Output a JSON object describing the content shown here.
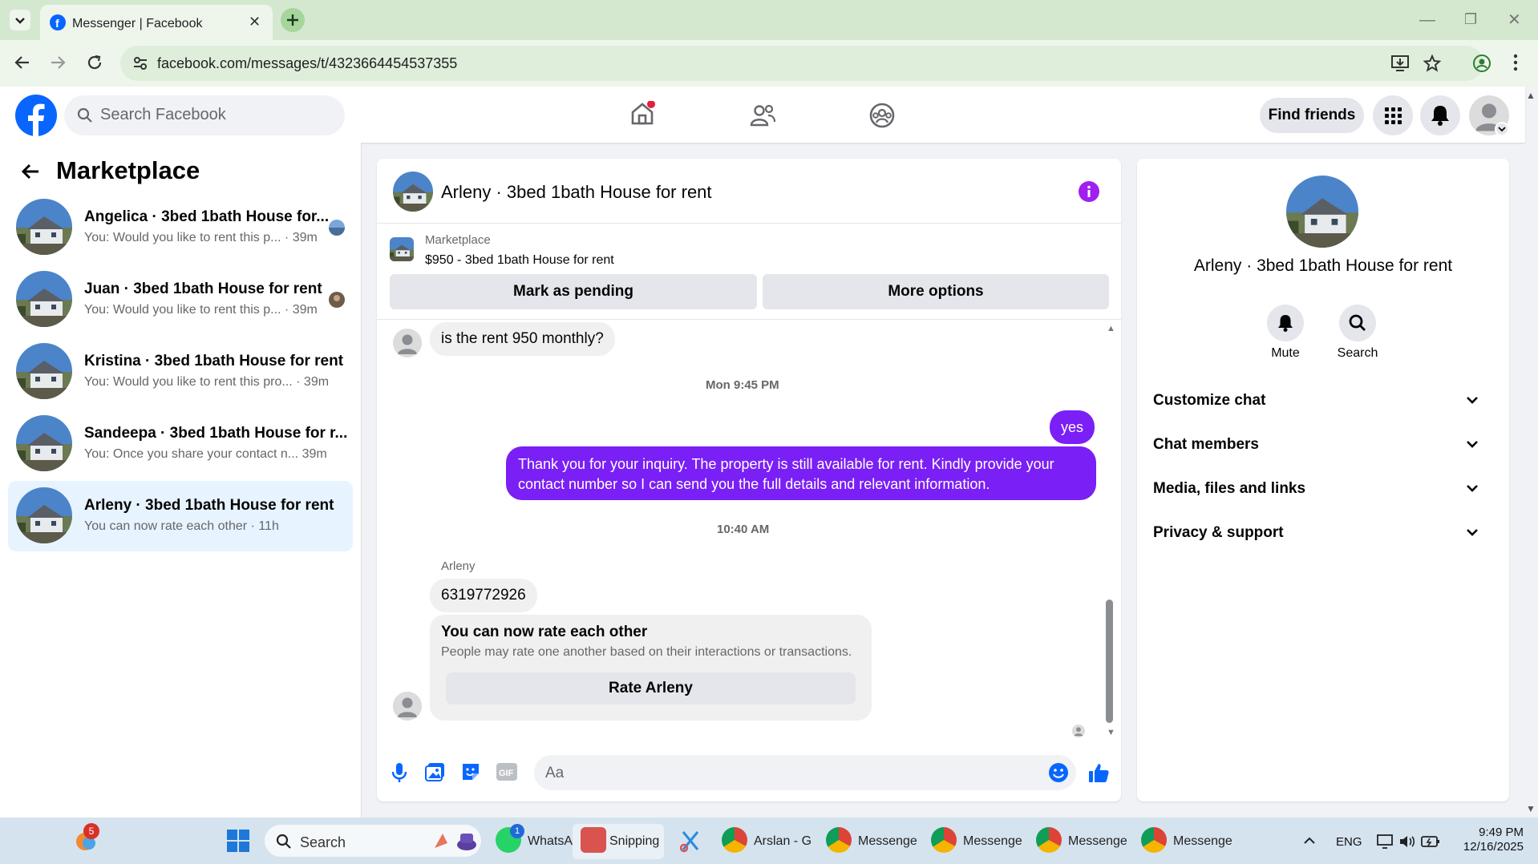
{
  "browser": {
    "tab_title": "Messenger | Facebook",
    "url": "facebook.com/messages/t/4323664454537355"
  },
  "header": {
    "search_placeholder": "Search Facebook",
    "find_friends": "Find friends"
  },
  "sidebar": {
    "title": "Marketplace",
    "conversations": [
      {
        "name": "Angelica · 3bed 1bath House for...",
        "preview": "You: Would you like to rent this p... · 39m"
      },
      {
        "name": "Juan · 3bed 1bath House for rent",
        "preview": "You: Would you like to rent this p... · 39m"
      },
      {
        "name": "Kristina · 3bed 1bath House for rent",
        "preview": "You: Would you like to rent this pro... · 39m"
      },
      {
        "name": "Sandeepa · 3bed 1bath House for r...",
        "preview": "You: Once you share your contact n...   39m"
      },
      {
        "name": "Arleny · 3bed 1bath House for rent",
        "preview": "You can now rate each other · 11h"
      }
    ]
  },
  "chat": {
    "title": "Arleny · 3bed 1bath House for rent",
    "marketplace_label": "Marketplace",
    "listing": "$950 - 3bed 1bath House for rent",
    "mark_pending": "Mark as pending",
    "more_options": "More options",
    "messages": {
      "q_rent": "is the rent 950 monthly?",
      "time1": "Mon 9:45 PM",
      "yes": "yes",
      "reply_line1": "Thank you for your inquiry. The property is still available for rent. Kindly provide your",
      "reply_line2": "contact number so I can send you the full details and relevant information.",
      "time2": "10:40 AM",
      "sender": "Arleny",
      "phone": "6319772926"
    },
    "rate": {
      "title": "You can now rate each other",
      "subtitle": "People may rate one another based on their interactions or transactions.",
      "button": "Rate Arleny"
    },
    "composer_placeholder": "Aa"
  },
  "details": {
    "name": "Arleny · 3bed 1bath House for rent",
    "mute": "Mute",
    "search": "Search",
    "sections": [
      "Customize chat",
      "Chat members",
      "Media, files and links",
      "Privacy & support"
    ]
  },
  "taskbar": {
    "search": "Search",
    "apps": [
      "WhatsA",
      "Snipping",
      "Arslan - G",
      "Messenge",
      "Messenge",
      "Messenge",
      "Messenge"
    ],
    "weather_badge": "5",
    "whatsapp_badge": "1",
    "lang": "ENG",
    "time": "9:49 PM",
    "date": "12/16/2025"
  },
  "colors": {
    "accent": "#7a1ff5",
    "fb_blue": "#0866ff",
    "selected_row": "#e7f3ff"
  }
}
